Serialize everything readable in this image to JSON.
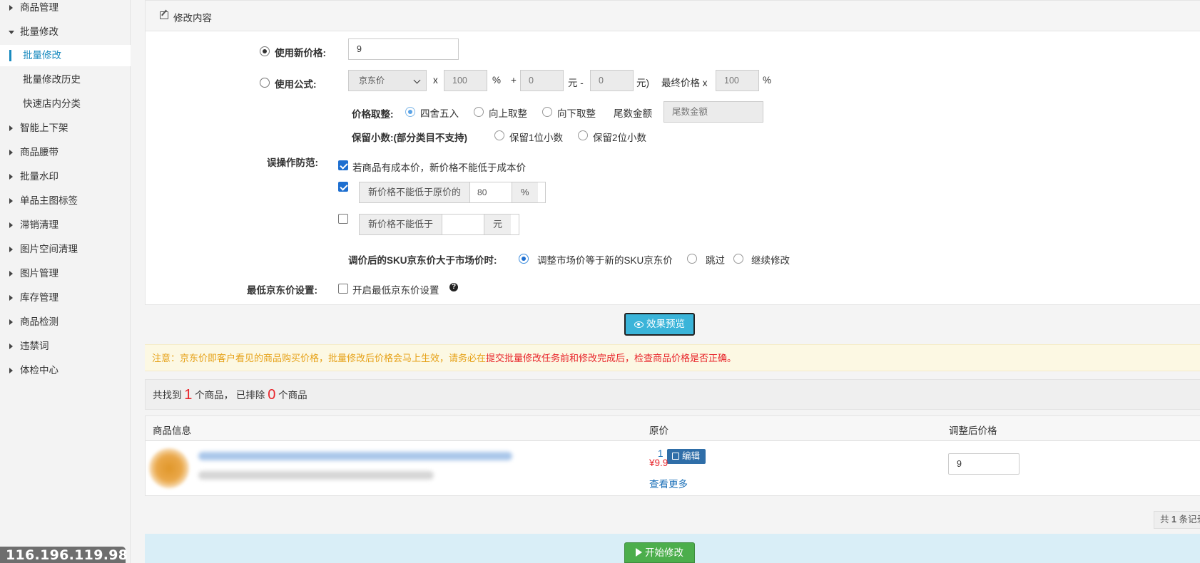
{
  "sidebar": {
    "items": [
      {
        "label": "商品管理"
      },
      {
        "label": "批量修改"
      },
      {
        "label": "批量修改"
      },
      {
        "label": "批量修改历史"
      },
      {
        "label": "快速店内分类"
      },
      {
        "label": "智能上下架"
      },
      {
        "label": "商品腰带"
      },
      {
        "label": "批量水印"
      },
      {
        "label": "单品主图标签"
      },
      {
        "label": "滞销清理"
      },
      {
        "label": "图片空间清理"
      },
      {
        "label": "图片管理"
      },
      {
        "label": "库存管理"
      },
      {
        "label": "商品检测"
      },
      {
        "label": "违禁词"
      },
      {
        "label": "体检中心"
      }
    ],
    "ip": "116.196.119.98"
  },
  "panel": {
    "title": "修改内容",
    "new_price": {
      "label": "使用新价格:",
      "value": "9"
    },
    "formula": {
      "label": "使用公式:",
      "select_value": "京东价",
      "x": "x",
      "pct_value": "100",
      "pct": "%",
      "plus": "+",
      "plus_value": "0",
      "yuan_minus": "元 -",
      "minus_value": "0",
      "yuan_paren": "元)",
      "final_label": "最终价格 x",
      "final_value": "100",
      "final_pct": "%"
    },
    "rounding": {
      "label": "价格取整:",
      "opt1": "四舍五入",
      "opt2": "向上取整",
      "opt3": "向下取整",
      "tail_label": "尾数金额",
      "tail_placeholder": "尾数金额"
    },
    "decimals": {
      "label": "保留小数:(部分类目不支持)",
      "opt1": "保留1位小数",
      "opt2": "保留2位小数"
    },
    "protect": {
      "label": "误操作防范:",
      "cost_text": "若商品有成本价，新价格不能低于成本价",
      "not_below_orig": "新价格不能低于原价的",
      "orig_pct_value": "80",
      "pct": "%",
      "not_below": "新价格不能低于",
      "yuan": "元"
    },
    "sku": {
      "label": "调价后的SKU京东价大于市场价时:",
      "opt1": "调整市场价等于新的SKU京东价",
      "opt2": "跳过",
      "opt3": "继续修改"
    },
    "min_price": {
      "label": "最低京东价设置:",
      "check_text": "开启最低京东价设置",
      "help": "?"
    }
  },
  "preview_button": "效果预览",
  "notice": {
    "part1": "注意：京东价即客户看见的商品购买价格，批量修改后价格会马上生效，请务必在",
    "part2": "提交批量修改任务前和修改完成后，检查商品价格是否正确。"
  },
  "found": {
    "pre": "共找到",
    "count": "1",
    "mid": "个商品， 已排除",
    "excluded": "0",
    "post": "个商品"
  },
  "table": {
    "headers": [
      "商品信息",
      "原价",
      "调整后价格"
    ],
    "row": {
      "suffix": "1",
      "edit_label": "编辑",
      "price": "¥9.9",
      "more": "查看更多",
      "new_price": "9"
    }
  },
  "pager": {
    "prefix": "共",
    "count": "1",
    "suffix": "条记录"
  },
  "start_button": "开始修改",
  "colors": {
    "accent": "#1a8bbf",
    "danger": "#e8242a",
    "warning": "#e6a117",
    "preview_btn": "#3ab4d9",
    "start_btn": "#4cae4c"
  }
}
